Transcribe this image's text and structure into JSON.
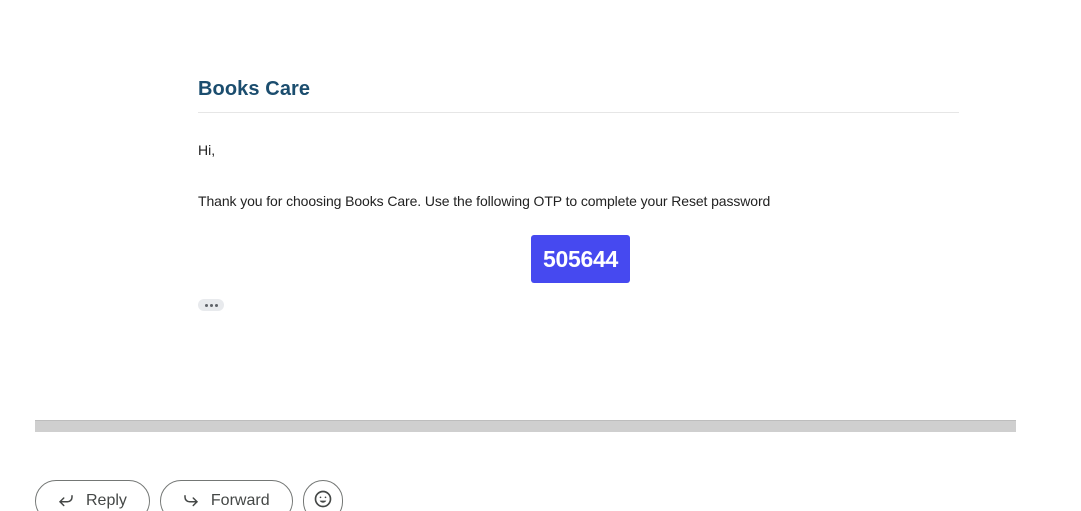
{
  "email": {
    "brand": "Books Care",
    "greeting": "Hi,",
    "message": "Thank you for choosing Books Care. Use the following OTP to complete your Reset password",
    "otp": "505644",
    "otp_color": "#4649f0",
    "brand_color": "#1b4d6e"
  },
  "actions": {
    "reply_label": "Reply",
    "forward_label": "Forward",
    "reply_icon": "reply-arrow-icon",
    "forward_icon": "forward-arrow-icon",
    "emoji_icon": "emoji-smile-icon"
  }
}
